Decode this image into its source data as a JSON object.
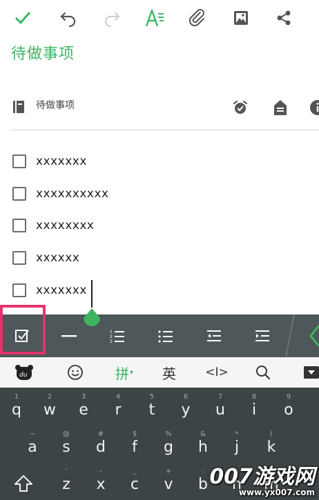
{
  "toolbar": {
    "icons": [
      "check-icon",
      "undo-icon",
      "redo-icon",
      "text-format-icon",
      "attach-icon",
      "image-icon",
      "share-icon"
    ],
    "accent": "#3cb563"
  },
  "note": {
    "title": "待做事项",
    "notebook": "待做事项"
  },
  "todos": [
    {
      "text": "xxxxxxx"
    },
    {
      "text": "xxxxxxxxxx"
    },
    {
      "text": "xxxxxxxx"
    },
    {
      "text": "xxxxxx"
    },
    {
      "text": "xxxxxxx"
    }
  ],
  "format_bar": {
    "icons": [
      "checkbox-icon",
      "divider-line-icon",
      "numbered-list-icon",
      "bullet-list-icon",
      "outdent-icon",
      "indent-icon"
    ],
    "highlight_color": "#e5336b"
  },
  "keyboard_top": {
    "pinyin": "拼",
    "english": "英",
    "cursor_symbol": "<I>"
  },
  "keyboard": {
    "row1": [
      [
        "1",
        "q"
      ],
      [
        "2",
        "w"
      ],
      [
        "3",
        "e"
      ],
      [
        "4",
        "r"
      ],
      [
        "5",
        "t"
      ],
      [
        "6",
        "y"
      ],
      [
        "7",
        "u"
      ],
      [
        "8",
        "i"
      ],
      [
        "9",
        "o"
      ]
    ],
    "row2": [
      [
        "~",
        "a"
      ],
      [
        "@",
        "s"
      ],
      [
        "#",
        "d"
      ],
      [
        "$",
        "f"
      ],
      [
        "%",
        "g"
      ],
      [
        "&",
        "h"
      ],
      [
        "*",
        "j"
      ],
      [
        "(",
        "k"
      ]
    ],
    "row3": [
      [
        "'",
        "z"
      ],
      [
        "-",
        "x"
      ],
      [
        "_",
        "c"
      ],
      [
        "+",
        "v"
      ],
      [
        ":",
        "b"
      ],
      [
        "",
        "n"
      ],
      [
        "",
        "m"
      ]
    ]
  },
  "watermark": {
    "brand": "007游戏网",
    "url": "www.yx007.com"
  }
}
